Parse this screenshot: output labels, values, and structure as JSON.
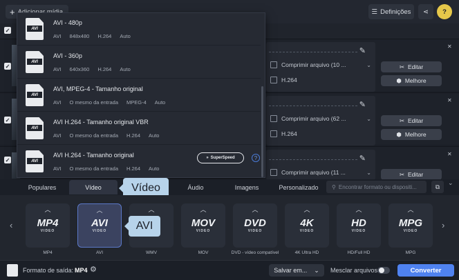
{
  "topbar": {
    "add_media": "Adicionar mídia",
    "settings": "Definições"
  },
  "rows": [
    {
      "file_size": "Comprimir arquivo (10 ...",
      "codec": "H.264",
      "edit": "Editar",
      "enhance": "Melhore"
    },
    {
      "file_size": "Comprimir arquivo (62 ...",
      "codec": "H.264",
      "edit": "Editar",
      "enhance": "Melhore"
    },
    {
      "file_size": "Comprimir arquivo (11 ...",
      "codec": "",
      "edit": "Editar",
      "enhance": ""
    }
  ],
  "dropdown": {
    "items": [
      {
        "title": "AVI - 480p",
        "meta": [
          "AVI",
          "848x480",
          "H.264",
          "Auto"
        ]
      },
      {
        "title": "AVI - 360p",
        "meta": [
          "AVI",
          "640x360",
          "H.264",
          "Auto"
        ]
      },
      {
        "title": "AVI, MPEG-4 - Tamanho original",
        "meta": [
          "AVI",
          "O mesmo da entrada",
          "MPEG-4",
          "Auto"
        ]
      },
      {
        "title": "AVI H.264 - Tamanho original VBR",
        "meta": [
          "AVI",
          "O mesmo da entrada",
          "H.264",
          "Auto"
        ]
      },
      {
        "title": "AVI H.264 - Tamanho original",
        "meta": [
          "AVI",
          "O mesmo da entrada",
          "H.264",
          "Auto"
        ]
      }
    ],
    "superspeed": "SuperSpeed",
    "file_badge": "AVI"
  },
  "tabs": [
    "Populares",
    "Vídeo",
    "Áudio",
    "Imagens",
    "Personalizado"
  ],
  "search_placeholder": "Encontrar formato ou dispositi...",
  "tooltips": {
    "video": "Vídeo",
    "avi": "AVI"
  },
  "formats": [
    {
      "logo": "MP4",
      "sub": "VIDEO",
      "label": "MP4"
    },
    {
      "logo": "AVI",
      "sub": "VIDEO",
      "label": "AVI"
    },
    {
      "logo": "",
      "sub": "",
      "label": "WMV"
    },
    {
      "logo": "MOV",
      "sub": "VIDEO",
      "label": "MOV"
    },
    {
      "logo": "DVD",
      "sub": "VIDEO",
      "label": "DVD - vídeo compatível"
    },
    {
      "logo": "4K",
      "sub": "VIDEO",
      "label": "4K Ultra HD"
    },
    {
      "logo": "HD",
      "sub": "VIDEO",
      "label": "HD/Full HD"
    },
    {
      "logo": "MPG",
      "sub": "VIDEO",
      "label": "MPG"
    }
  ],
  "bottom": {
    "output_label": "Formato de saída:",
    "output_value": "MP4",
    "save_to": "Salvar em...",
    "merge": "Mesclar arquivos:",
    "convert": "Converter"
  },
  "colors": {
    "accent": "#4f82f0",
    "tooltip": "#b7d3ea",
    "background": "#1b1f27"
  }
}
